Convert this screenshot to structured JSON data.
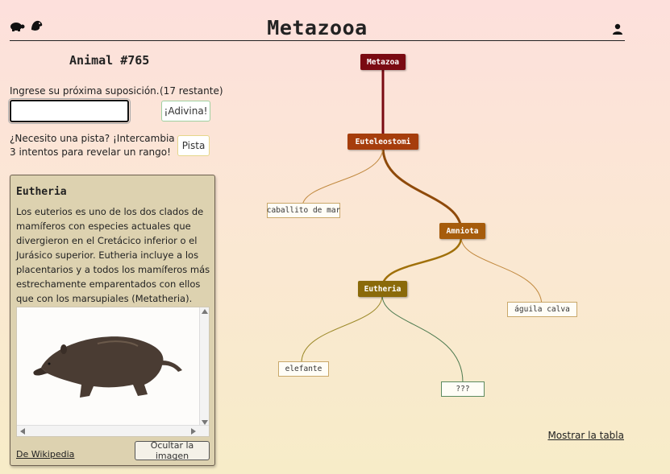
{
  "header": {
    "title": "Metazooa",
    "icons": [
      "turtle-icon",
      "bird-icon",
      "user-icon"
    ]
  },
  "game": {
    "animal_number": "Animal #765",
    "prompt": "Ingrese su próxima suposición.",
    "remaining": "(17 restante)",
    "input_value": "",
    "guess_button": "¡Adivina!",
    "hint_text": "¿Necesito una pista? ¡Intercambia 3 intentos para revelar un rango!",
    "hint_button": "Pista"
  },
  "info_card": {
    "title": "Eutheria",
    "description": "Los euterios es uno de los dos clados de mamíferos con especies actuales que divergieron en el Cretácico inferior o el Jurásico superior. Eutheria incluye a los placentarios y a todos los mamíferos más estrechamente emparentados con ellos que con los marsupiales (Metatheria).",
    "source_link": "De Wikipedia",
    "hide_image_button": "Ocultar la imagen"
  },
  "tree": {
    "nodes": [
      {
        "label": "Metazoa",
        "kind": "rank",
        "color": "#7a0a12"
      },
      {
        "label": "Euteleostomi",
        "kind": "rank",
        "color": "#a63d0c"
      },
      {
        "label": "caballito de mar",
        "kind": "guess"
      },
      {
        "label": "Amniota",
        "kind": "rank",
        "color": "#a65c0c"
      },
      {
        "label": "Eutheria",
        "kind": "rank",
        "color": "#8a6a0a"
      },
      {
        "label": "águila calva",
        "kind": "guess"
      },
      {
        "label": "elefante",
        "kind": "guess"
      },
      {
        "label": "???",
        "kind": "unknown"
      }
    ]
  },
  "footer": {
    "show_table": "Mostrar la tabla"
  }
}
